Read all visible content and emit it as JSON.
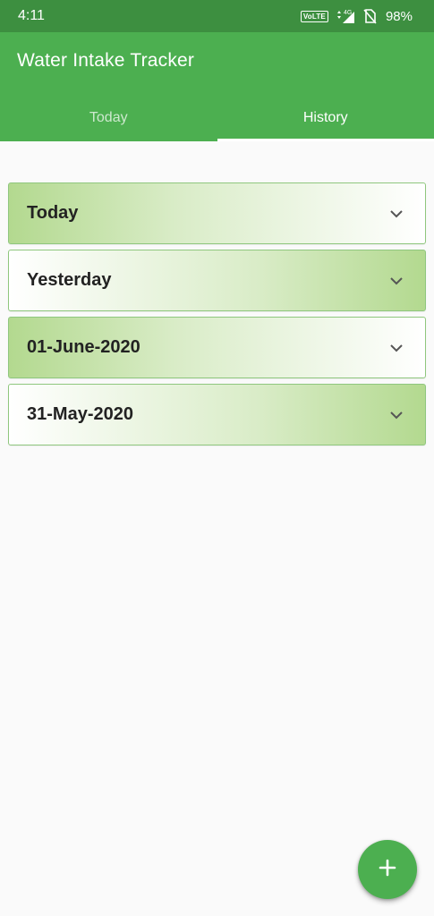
{
  "status_bar": {
    "time": "4:11",
    "volte": "VoLTE",
    "network": "4G",
    "battery": "98%"
  },
  "app_bar": {
    "title": "Water Intake Tracker",
    "tabs": [
      {
        "label": "Today",
        "active": false
      },
      {
        "label": "History",
        "active": true
      }
    ]
  },
  "history": {
    "items": [
      {
        "label": "Today",
        "icon": "chevron-down-icon"
      },
      {
        "label": "Yesterday",
        "icon": "chevron-down-icon"
      },
      {
        "label": "01-June-2020",
        "icon": "chevron-down-icon"
      },
      {
        "label": "31-May-2020",
        "icon": "chevron-down-icon"
      }
    ]
  },
  "fab": {
    "icon": "plus-icon"
  },
  "colors": {
    "primary": "#4caf50",
    "primary_dark": "#3d8f40",
    "card_accent": "#b3d98f"
  }
}
